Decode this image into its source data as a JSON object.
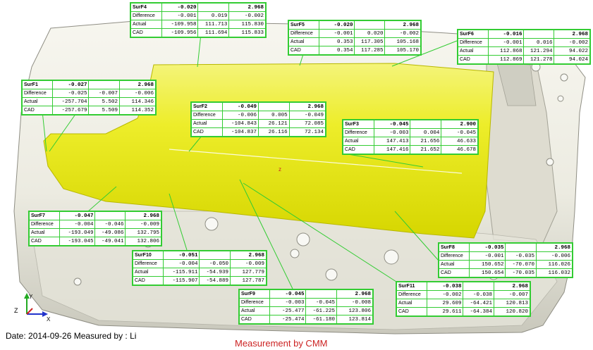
{
  "colors": {
    "part": "#f0f0f0",
    "surface": "#eeee22",
    "callout_border": "#33cc33",
    "title_red": "#cc2222"
  },
  "footer": {
    "date_line": "Date: 2014-09-26  Measured by : Li",
    "title": "Measurement by CMM"
  },
  "axes": {
    "x": "X",
    "y": "Y",
    "z": "Z"
  },
  "callouts": [
    {
      "name": "SurF1",
      "dev": "-0.027",
      "tol": "2.968",
      "rows": [
        {
          "label": "Difference",
          "vals": [
            "-0.025",
            "-0.007",
            "-0.006"
          ]
        },
        {
          "label": "Actual",
          "vals": [
            "-257.704",
            "5.502",
            "114.346"
          ]
        },
        {
          "label": "CAD",
          "vals": [
            "-257.679",
            "5.509",
            "114.352"
          ]
        }
      ]
    },
    {
      "name": "SurF2",
      "dev": "-0.049",
      "tol": "2.968",
      "rows": [
        {
          "label": "Difference",
          "vals": [
            "-0.006",
            "0.005",
            "-0.049"
          ]
        },
        {
          "label": "Actual",
          "vals": [
            "-104.843",
            "26.121",
            "72.085"
          ]
        },
        {
          "label": "CAD",
          "vals": [
            "-104.837",
            "26.116",
            "72.134"
          ]
        }
      ]
    },
    {
      "name": "SurF3",
      "dev": "-0.045",
      "tol": "2.900",
      "rows": [
        {
          "label": "Difference",
          "vals": [
            "-0.003",
            "0.004",
            "-0.045"
          ]
        },
        {
          "label": "Actual",
          "vals": [
            "147.413",
            "21.656",
            "46.633"
          ]
        },
        {
          "label": "CAD",
          "vals": [
            "147.416",
            "21.652",
            "46.678"
          ]
        }
      ]
    },
    {
      "name": "SurF4",
      "dev": "-0.020",
      "tol": "2.968",
      "rows": [
        {
          "label": "Difference",
          "vals": [
            "-0.001",
            "0.019",
            "-0.002"
          ]
        },
        {
          "label": "Actual",
          "vals": [
            "-109.958",
            "111.713",
            "115.830"
          ]
        },
        {
          "label": "CAD",
          "vals": [
            "-109.956",
            "111.694",
            "115.833"
          ]
        }
      ]
    },
    {
      "name": "SurF5",
      "dev": "-0.020",
      "tol": "2.968",
      "rows": [
        {
          "label": "Difference",
          "vals": [
            "-0.001",
            "0.020",
            "-0.002"
          ]
        },
        {
          "label": "Actual",
          "vals": [
            "0.353",
            "117.305",
            "105.168"
          ]
        },
        {
          "label": "CAD",
          "vals": [
            "0.354",
            "117.285",
            "105.170"
          ]
        }
      ]
    },
    {
      "name": "SurF6",
      "dev": "-0.016",
      "tol": "2.968",
      "rows": [
        {
          "label": "Difference",
          "vals": [
            "-0.001",
            "0.016",
            "-0.002"
          ]
        },
        {
          "label": "Actual",
          "vals": [
            "112.868",
            "121.294",
            "94.022"
          ]
        },
        {
          "label": "CAD",
          "vals": [
            "112.869",
            "121.278",
            "94.024"
          ]
        }
      ]
    },
    {
      "name": "SurF7",
      "dev": "-0.047",
      "tol": "2.968",
      "rows": [
        {
          "label": "Difference",
          "vals": [
            "-0.004",
            "-0.046",
            "-0.009"
          ]
        },
        {
          "label": "Actual",
          "vals": [
            "-193.049",
            "-49.086",
            "132.795"
          ]
        },
        {
          "label": "CAD",
          "vals": [
            "-193.045",
            "-49.041",
            "132.806"
          ]
        }
      ]
    },
    {
      "name": "SurF8",
      "dev": "-0.035",
      "tol": "2.968",
      "rows": [
        {
          "label": "Difference",
          "vals": [
            "-0.001",
            "-0.035",
            "-0.006"
          ]
        },
        {
          "label": "Actual",
          "vals": [
            "150.652",
            "-70.070",
            "116.026"
          ]
        },
        {
          "label": "CAD",
          "vals": [
            "150.654",
            "-70.035",
            "116.032"
          ]
        }
      ]
    },
    {
      "name": "SurF9",
      "dev": "-0.045",
      "tol": "2.968",
      "rows": [
        {
          "label": "Difference",
          "vals": [
            "-0.003",
            "-0.045",
            "-0.008"
          ]
        },
        {
          "label": "Actual",
          "vals": [
            "-25.477",
            "-61.225",
            "123.806"
          ]
        },
        {
          "label": "CAD",
          "vals": [
            "-25.474",
            "-61.180",
            "123.814"
          ]
        }
      ]
    },
    {
      "name": "SurF10",
      "dev": "-0.051",
      "tol": "2.968",
      "rows": [
        {
          "label": "Difference",
          "vals": [
            "-0.004",
            "-0.050",
            "-0.009"
          ]
        },
        {
          "label": "Actual",
          "vals": [
            "-115.911",
            "-54.939",
            "127.779"
          ]
        },
        {
          "label": "CAD",
          "vals": [
            "-115.907",
            "-54.889",
            "127.787"
          ]
        }
      ]
    },
    {
      "name": "SurF11",
      "dev": "-0.038",
      "tol": "2.968",
      "rows": [
        {
          "label": "Difference",
          "vals": [
            "-0.002",
            "-0.038",
            "-0.007"
          ]
        },
        {
          "label": "Actual",
          "vals": [
            "29.609",
            "-64.421",
            "120.813"
          ]
        },
        {
          "label": "CAD",
          "vals": [
            "29.611",
            "-64.384",
            "120.820"
          ]
        }
      ]
    }
  ]
}
